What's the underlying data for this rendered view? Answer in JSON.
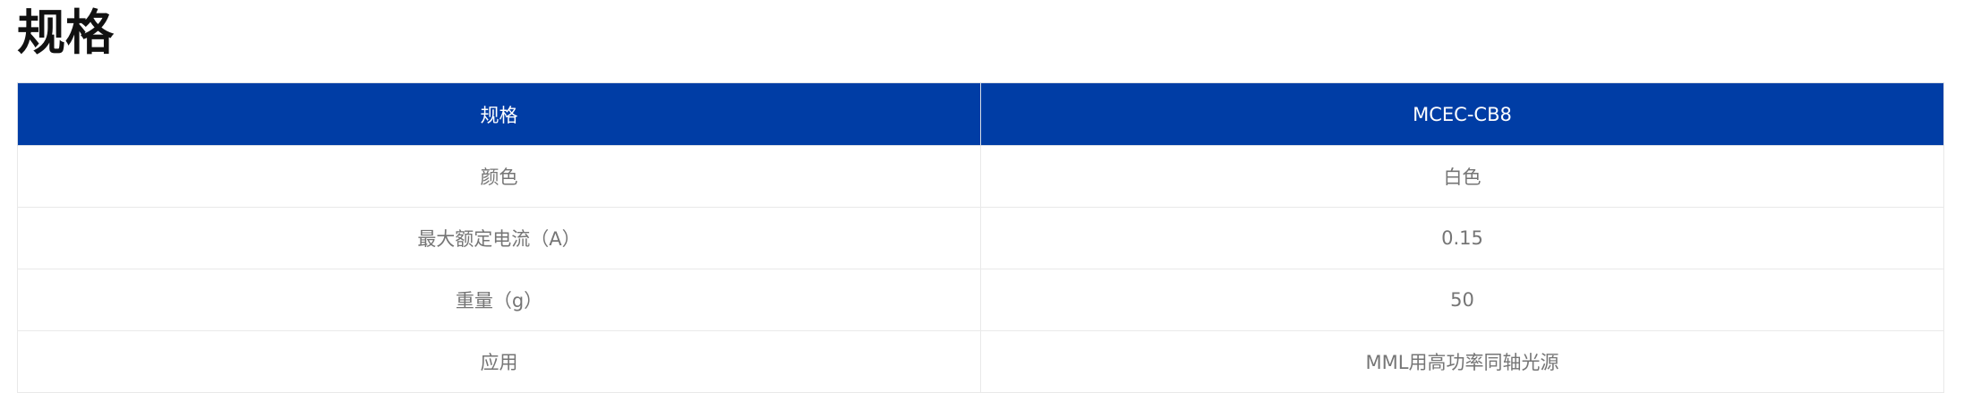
{
  "page": {
    "title": "规格"
  },
  "table": {
    "headers": [
      "规格",
      "MCEC-CB8"
    ],
    "rows": [
      [
        "颜色",
        "白色"
      ],
      [
        "最大额定电流（A）",
        "0.15"
      ],
      [
        "重量（g）",
        "50"
      ],
      [
        "应用",
        "MML用高功率同轴光源"
      ]
    ]
  },
  "colors": {
    "header_background": "#003da5",
    "header_text": "#ffffff",
    "cell_text": "#757575",
    "border": "#e9e9e9"
  }
}
